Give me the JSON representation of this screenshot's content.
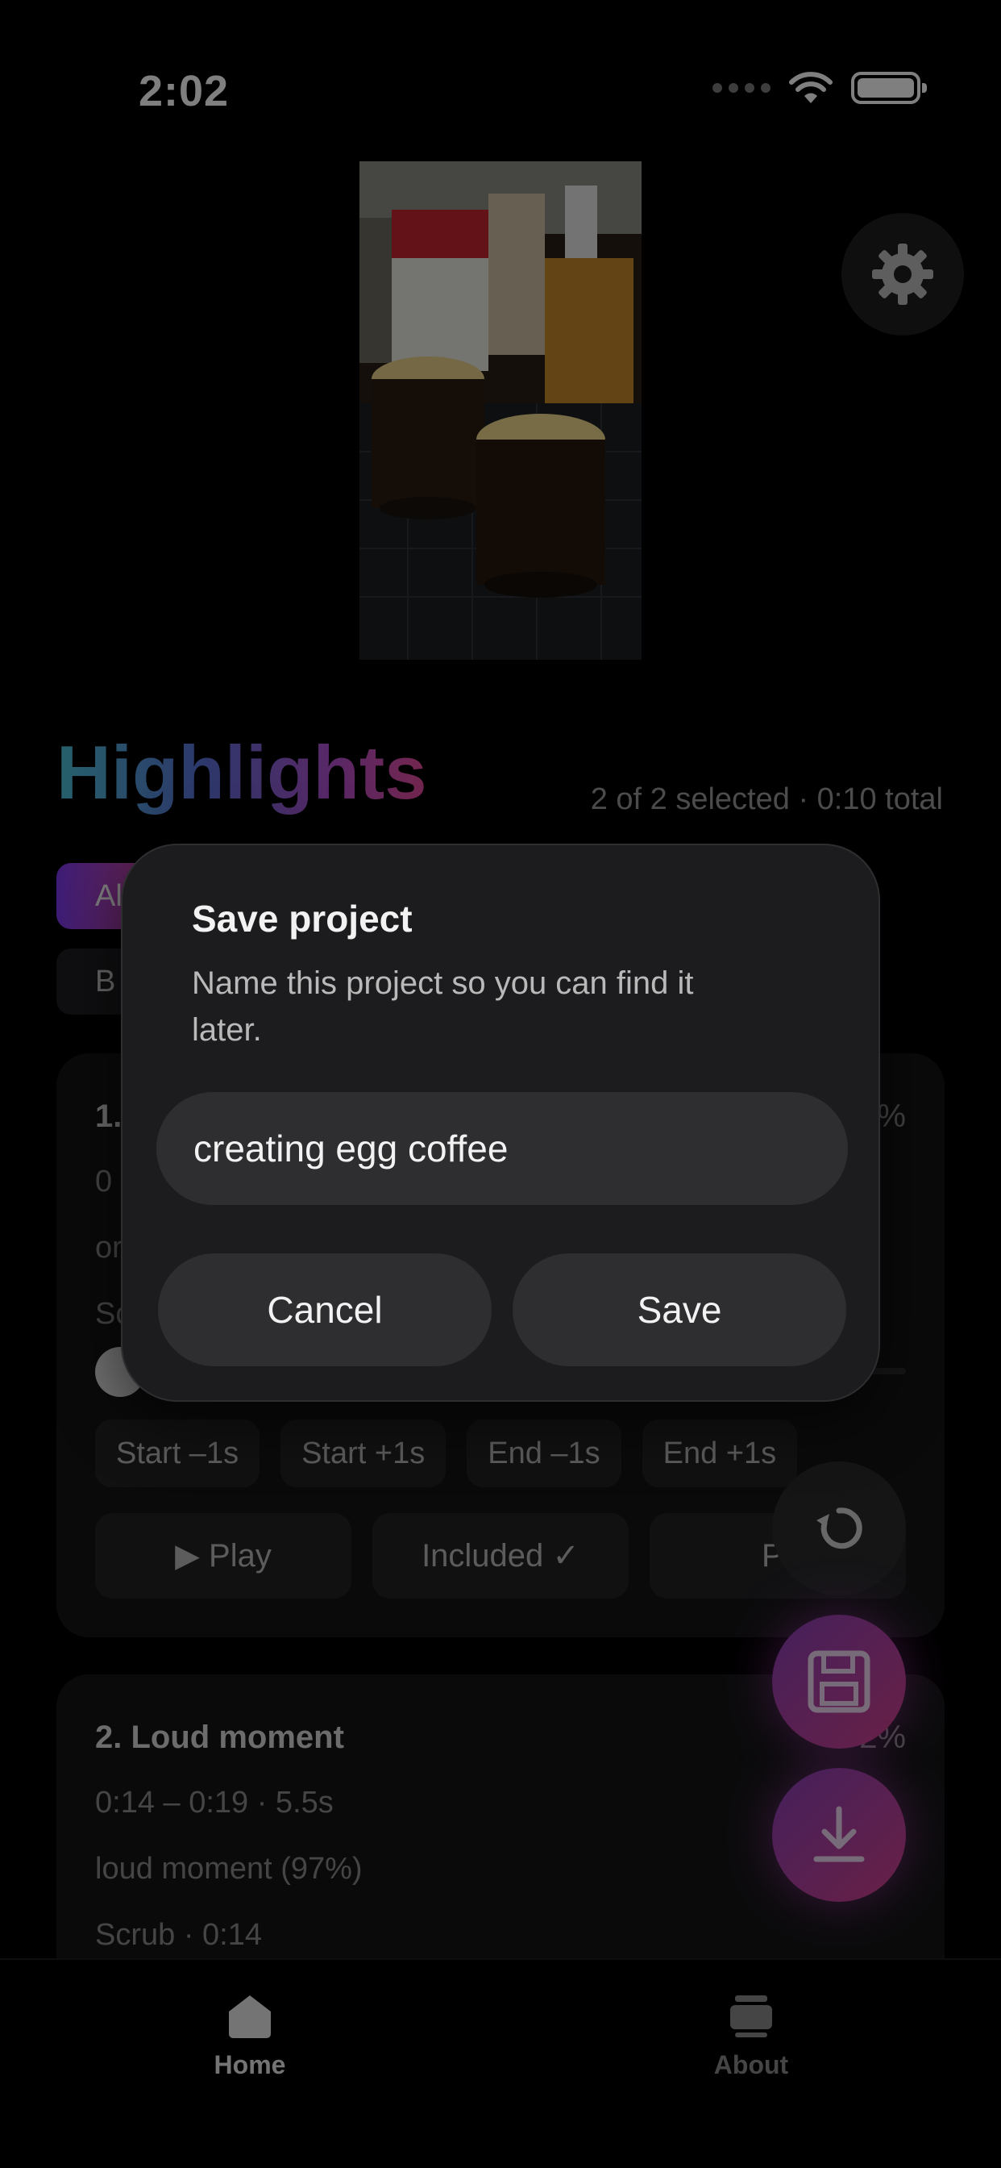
{
  "status_bar": {
    "time": "2:02"
  },
  "highlights": {
    "title": "Highlights",
    "summary": "2 of 2 selected · 0:10 total",
    "filters": [
      "All",
      "B"
    ]
  },
  "cards": [
    {
      "title": "1.",
      "percent": "%",
      "time_range": "0",
      "reason": "or",
      "scrub": "Sc",
      "buttons": [
        "Start –1s",
        "Start +1s",
        "End –1s",
        "End +1s"
      ],
      "actions": [
        "▶ Play",
        "Included ✓",
        "Pr"
      ]
    },
    {
      "title": "2. Loud moment",
      "percent": "2%",
      "time_range": "0:14 – 0:19 · 5.5s",
      "reason": "loud moment (97%)",
      "scrub": "Scrub · 0:14"
    }
  ],
  "dialog": {
    "title": "Save project",
    "message": "Name this project so you can find it later.",
    "input_value": "creating egg coffee",
    "cancel_label": "Cancel",
    "save_label": "Save"
  },
  "tabbar": {
    "home_label": "Home",
    "about_label": "About"
  },
  "icons": {
    "settings": "gear-icon",
    "undo": "undo-icon",
    "save": "floppy-disk-icon",
    "download": "download-icon",
    "home": "home-icon",
    "about": "cards-icon"
  },
  "colors": {
    "accent_start": "#7c3aed",
    "accent_end": "#e64d9b",
    "background": "#000000"
  }
}
